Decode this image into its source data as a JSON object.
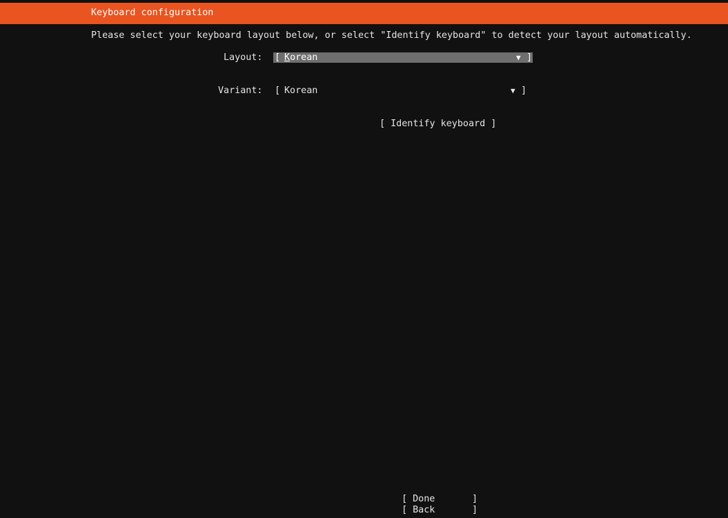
{
  "header": {
    "title": "Keyboard configuration",
    "color": "#e95420"
  },
  "instructions": "Please select your keyboard layout below, or select \"Identify keyboard\" to detect your layout automatically.",
  "layout": {
    "label": "Layout:",
    "open_bracket": "[",
    "value_first": "K",
    "value_rest": "orean",
    "arrow": "▼",
    "close_bracket": "]"
  },
  "variant": {
    "label": "Variant:",
    "open_bracket": "[",
    "value": "Korean",
    "arrow": "▼",
    "close_bracket": "]"
  },
  "identify_button": {
    "label": "[ Identify keyboard ]"
  },
  "footer": {
    "done_open": "[ Done",
    "done_close": "]",
    "back_open": "[ Back",
    "back_close": "]"
  }
}
